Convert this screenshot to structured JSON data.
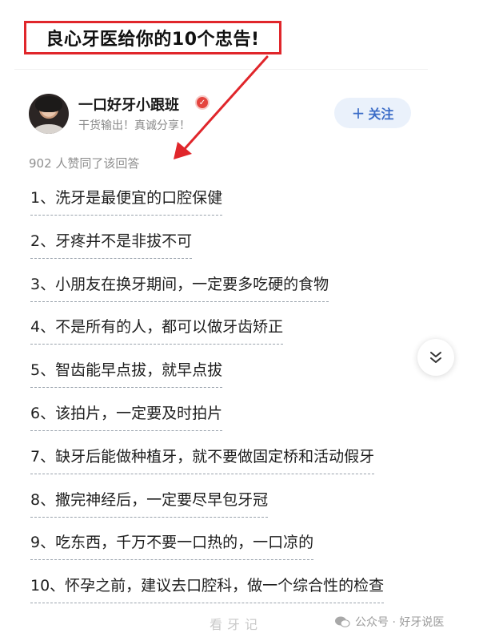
{
  "callout": {
    "text": "良心牙医给你的10个忠告!"
  },
  "author": {
    "name": "一口好牙小跟班",
    "bio": "干货输出！真诚分享！",
    "follow_label": "关注"
  },
  "likes_text": "902 人赞同了该回答",
  "items": [
    "1、洗牙是最便宜的口腔保健",
    "2、牙疼并不是非拔不可",
    "3、小朋友在换牙期间，一定要多吃硬的食物",
    "4、不是所有的人，都可以做牙齿矫正",
    "5、智齿能早点拔，就早点拔",
    "6、该拍片，一定要及时拍片",
    "7、缺牙后能做种植牙，就不要做固定桥和活动假牙",
    "8、撒完神经后，一定要尽早包牙冠",
    "9、吃东西，千万不要一口热的，一口凉的",
    "10、怀孕之前，建议去口腔科，做一个综合性的检查"
  ],
  "watermark": {
    "left": "看牙记",
    "right": "公众号 · 好牙说医"
  },
  "colors": {
    "accent_red": "#e0262b",
    "follow_blue": "#3b6cc7"
  },
  "icons": {
    "scroll": "double-chevron-down-icon",
    "badge": "verified-badge-icon",
    "wechat": "wechat-icon"
  }
}
